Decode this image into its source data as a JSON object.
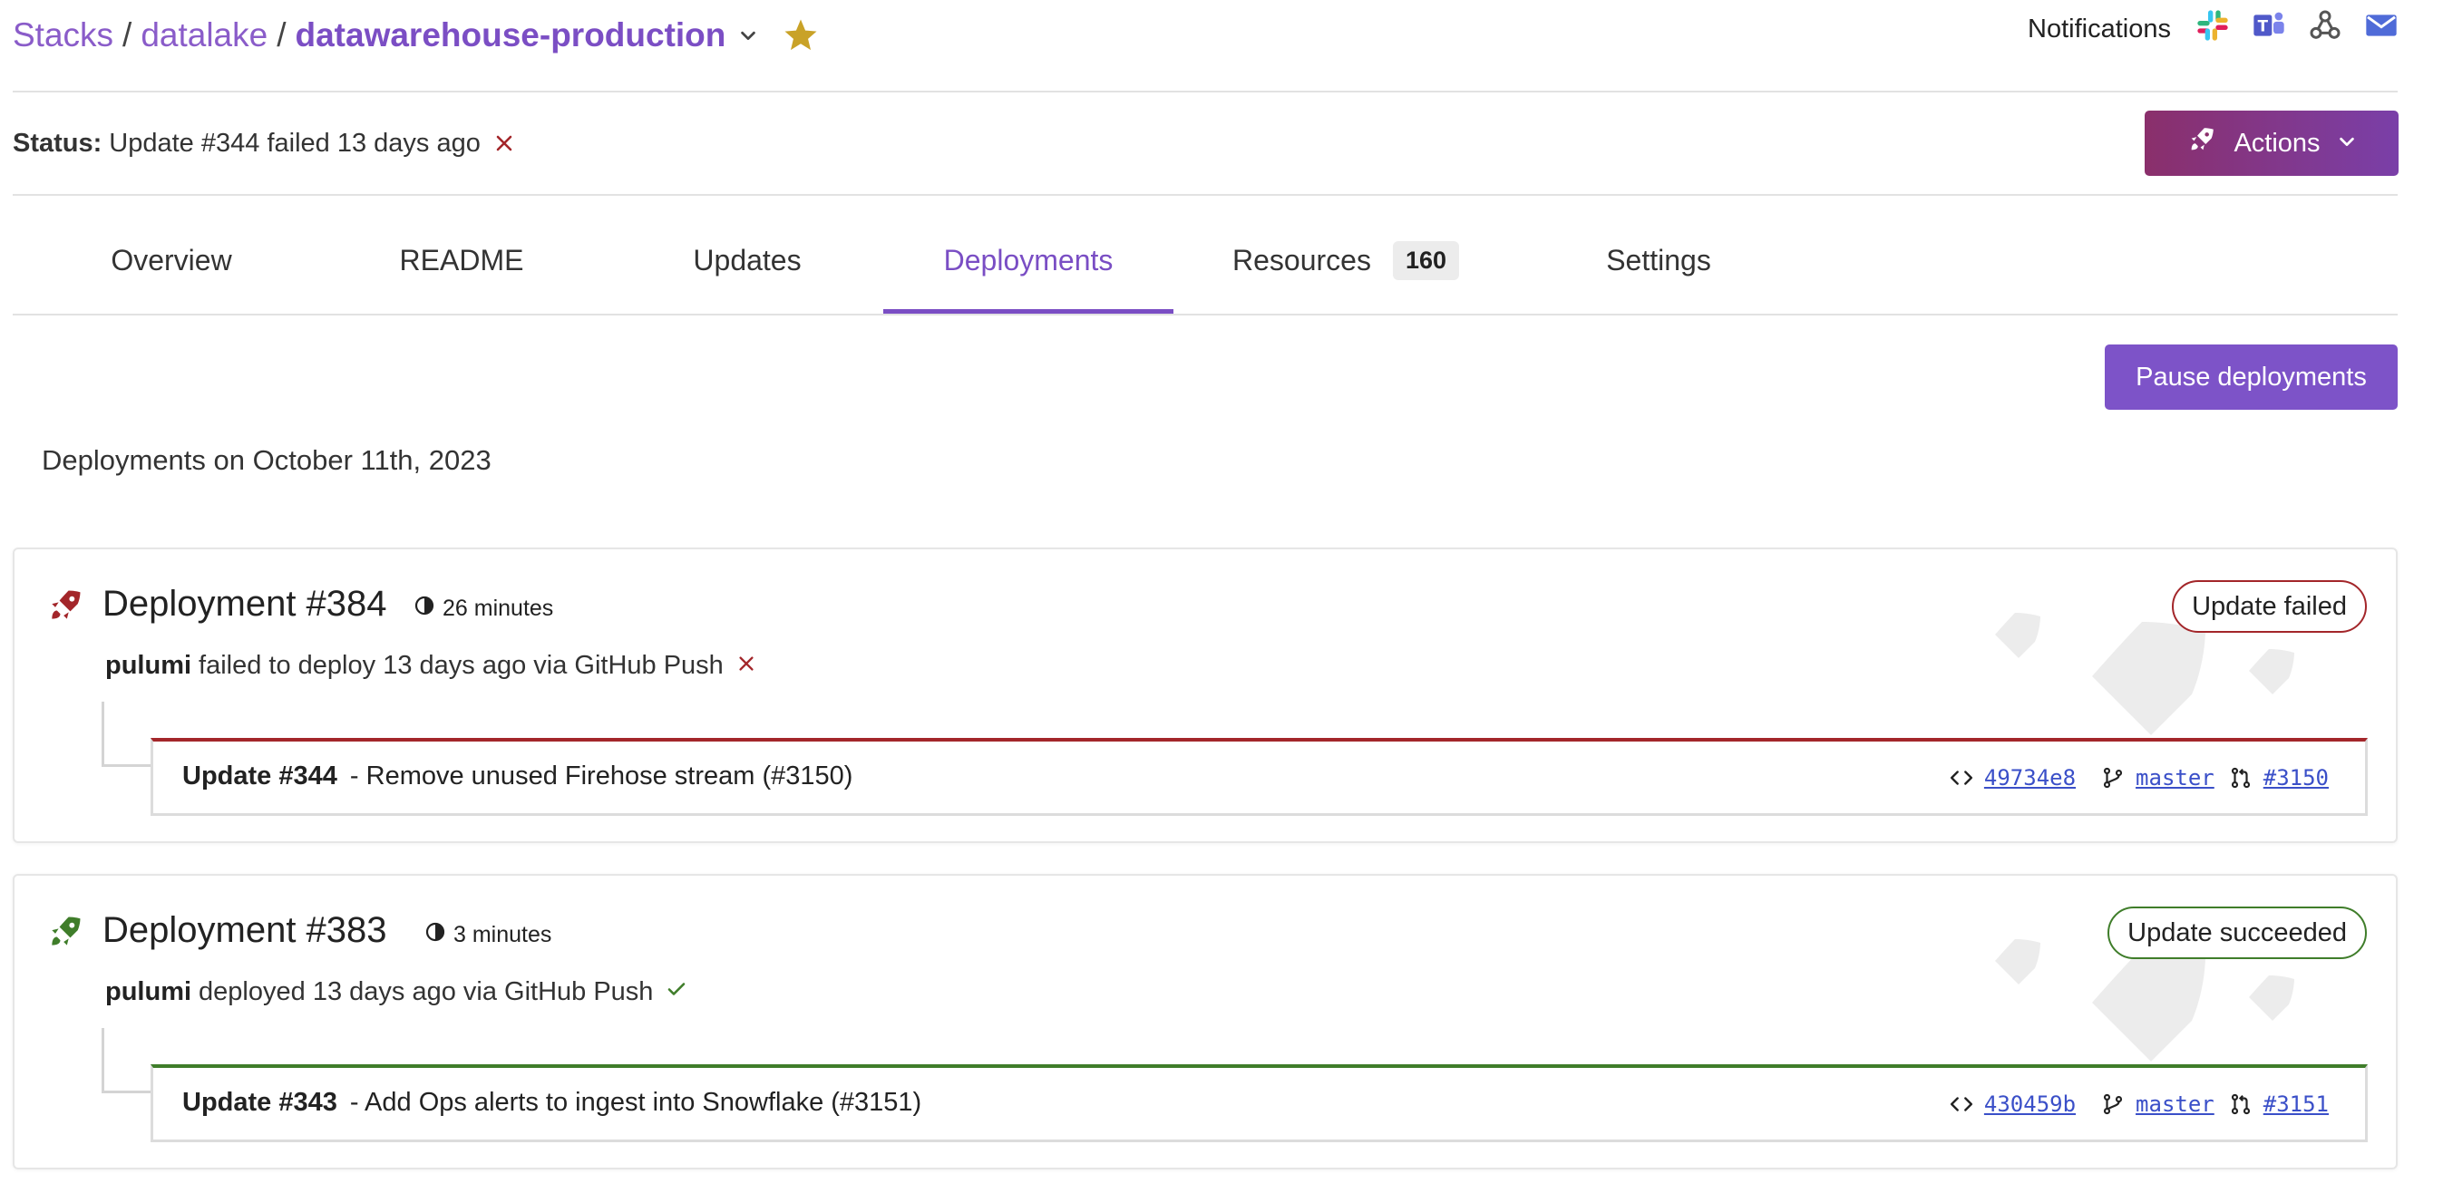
{
  "breadcrumb": {
    "org": "Stacks",
    "project": "datalake",
    "stack": "datawarehouse-production"
  },
  "notifications": {
    "label": "Notifications",
    "icons": [
      "slack-icon",
      "teams-icon",
      "webhook-icon",
      "email-icon"
    ]
  },
  "status": {
    "label": "Status:",
    "text": "Update #344 failed 13 days ago"
  },
  "actions_label": "Actions",
  "tabs": [
    {
      "label": "Overview",
      "active": false
    },
    {
      "label": "README",
      "active": false
    },
    {
      "label": "Updates",
      "active": false
    },
    {
      "label": "Deployments",
      "active": true
    },
    {
      "label": "Resources",
      "badge": "160",
      "active": false
    },
    {
      "label": "Settings",
      "active": false
    }
  ],
  "pause_label": "Pause deployments",
  "date_heading": "Deployments on October 11th, 2023",
  "deployments": [
    {
      "title": "Deployment #384",
      "duration": "26 minutes",
      "user": "pulumi",
      "text": "failed to deploy 13 days ago via GitHub Push",
      "status": "Update failed",
      "update_id": "Update #344",
      "update_desc": "- Remove unused Firehose stream (#3150)",
      "commit": "49734e8",
      "branch": "master",
      "pr": "#3150"
    },
    {
      "title": "Deployment #383",
      "duration": "3 minutes",
      "user": "pulumi",
      "text": "deployed 13 days ago via GitHub Push",
      "status": "Update succeeded",
      "update_id": "Update #343",
      "update_desc": "- Add Ops alerts to ingest into Snowflake (#3151)",
      "commit": "430459b",
      "branch": "master",
      "pr": "#3151"
    }
  ],
  "colors": {
    "brand_purple": "#7d53c8",
    "failed_red": "#a3262a",
    "success_green": "#3f7d2a",
    "link_blue": "#3a4fc8",
    "star_gold": "#c9a227"
  }
}
